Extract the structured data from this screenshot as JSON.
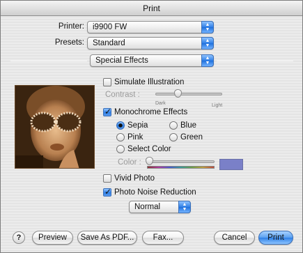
{
  "window": {
    "title": "Print"
  },
  "printer": {
    "label": "Printer:",
    "value": "i9900 FW"
  },
  "presets": {
    "label": "Presets:",
    "value": "Standard"
  },
  "panel": {
    "value": "Special Effects"
  },
  "simulate_illustration": {
    "label": "Simulate Illustration",
    "checked": false
  },
  "contrast": {
    "label": "Contrast :",
    "min_label": "Dark",
    "max_label": "Light",
    "level": 0.35
  },
  "monochrome": {
    "label": "Monochrome Effects",
    "checked": true,
    "options": [
      {
        "label": "Sepia",
        "checked": true
      },
      {
        "label": "Blue",
        "checked": false
      },
      {
        "label": "Pink",
        "checked": false
      },
      {
        "label": "Green",
        "checked": false
      },
      {
        "label": "Select Color",
        "checked": false
      }
    ],
    "color_label": "Color :",
    "swatch_color": "#7a80c8"
  },
  "vivid_photo": {
    "label": "Vivid Photo",
    "checked": false
  },
  "noise_reduction": {
    "label": "Photo Noise Reduction",
    "checked": true,
    "level": "Normal"
  },
  "buttons": {
    "help": "?",
    "preview": "Preview",
    "save_pdf": "Save As PDF...",
    "fax": "Fax...",
    "cancel": "Cancel",
    "print": "Print"
  },
  "colors": {
    "accent": "#2f7fe6",
    "sepia": "#b0784a"
  }
}
